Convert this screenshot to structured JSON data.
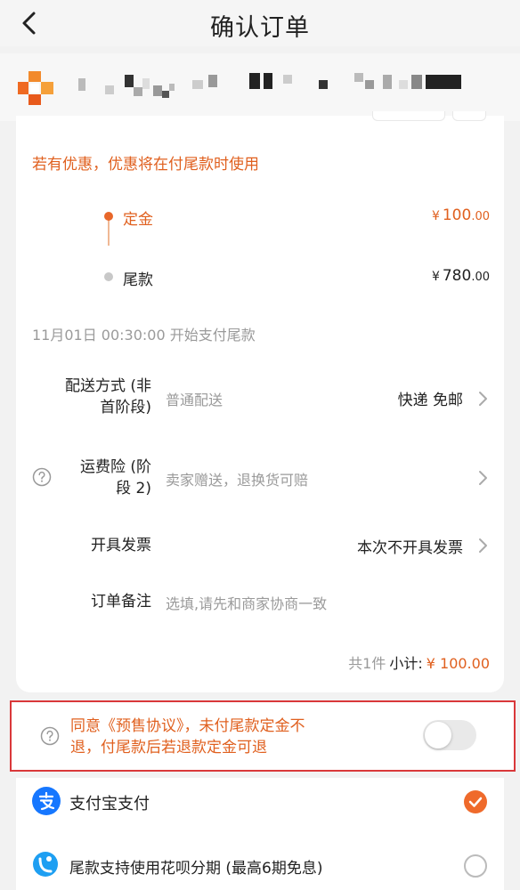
{
  "header": {
    "title": "确认订单"
  },
  "icons": {
    "back": "chevron-left-icon",
    "shop_logo": "shop-logo-icon",
    "help": "question-circle-icon",
    "chevron": "chevron-right-icon",
    "alipay": "alipay-icon",
    "huabei": "huabei-icon",
    "check": "check-icon"
  },
  "colors": {
    "accent": "#e0601f",
    "highlight_border": "#d9383a",
    "alipay_blue": "#1677ff"
  },
  "order": {
    "notice": "若有优惠，优惠将在付尾款时使用",
    "deposit": {
      "label": "定金",
      "currency": "¥",
      "amount_int": "100",
      "amount_dec": ".00"
    },
    "balance": {
      "label": "尾款",
      "currency": "¥",
      "amount_int": "780",
      "amount_dec": ".00"
    },
    "balance_start": "11月01日 00:30:00 开始支付尾款",
    "delivery": {
      "label_line1": "配送方式 (非",
      "label_line2": "首阶段)",
      "value": "普通配送",
      "right": "快递 免邮"
    },
    "insurance": {
      "label_line1": "运费险 (阶",
      "label_line2": "段 2)",
      "value": "卖家赠送，退换货可赔"
    },
    "invoice": {
      "label": "开具发票",
      "right": "本次不开具发票"
    },
    "remark": {
      "label": "订单备注",
      "placeholder": "选填,请先和商家协商一致"
    },
    "subtotal": {
      "count": "共1件",
      "label": "小计:",
      "amount": "¥ 100.00"
    }
  },
  "agreement": {
    "line1": "同意《预售协议》，未付尾款定金不",
    "line2": "退，付尾款后若退款定金可退",
    "toggle_on": false
  },
  "payment": {
    "alipay": {
      "label": "支付宝支付",
      "selected": true
    },
    "huabei": {
      "label": "尾款支持使用花呗分期 (最高6期免息)",
      "selected": false
    }
  }
}
